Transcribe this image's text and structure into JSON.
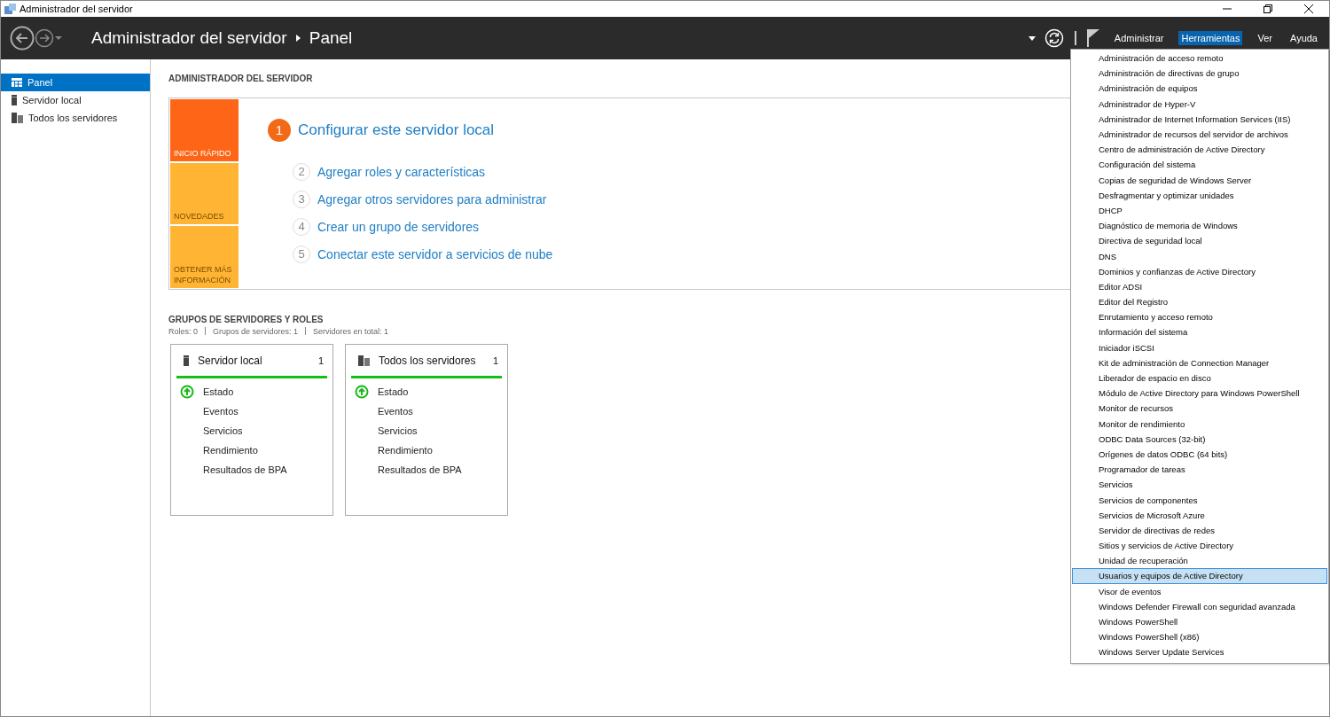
{
  "window": {
    "title": "Administrador del servidor"
  },
  "header": {
    "breadcrumb": [
      "Administrador del servidor",
      "Panel"
    ],
    "menus": [
      {
        "label": "Administrar",
        "selected": false
      },
      {
        "label": "Herramientas",
        "selected": true
      },
      {
        "label": "Ver",
        "selected": false
      },
      {
        "label": "Ayuda",
        "selected": false
      }
    ]
  },
  "sidebar": {
    "items": [
      {
        "label": "Panel",
        "kind": "dashboard",
        "selected": true
      },
      {
        "label": "Servidor local",
        "kind": "server",
        "selected": false
      },
      {
        "label": "Todos los servidores",
        "kind": "servers",
        "selected": false
      }
    ]
  },
  "welcome": {
    "heading": "ADMINISTRADOR DEL SERVIDOR",
    "tiles": [
      {
        "label": "INICIO RÁPIDO",
        "selected": true
      },
      {
        "label": "NOVEDADES",
        "selected": false
      },
      {
        "label": "OBTENER MÁS INFORMACIÓN",
        "selected": false
      }
    ],
    "steps": [
      {
        "number": "1",
        "label": "Configurar este servidor local",
        "kind": "main"
      },
      {
        "number": "2",
        "label": "Agregar roles y características",
        "kind": "step"
      },
      {
        "number": "3",
        "label": "Agregar otros servidores para administrar",
        "kind": "step"
      },
      {
        "number": "4",
        "label": "Crear un grupo de servidores",
        "kind": "step"
      },
      {
        "number": "5",
        "label": "Conectar este servidor a servicios de nube",
        "kind": "step"
      }
    ]
  },
  "groups": {
    "heading": "GRUPOS DE SERVIDORES Y ROLES",
    "summary": [
      "Roles: 0",
      "Grupos de servidores: 1",
      "Servidores en total: 1"
    ],
    "cards": [
      {
        "title": "Servidor local",
        "count": "1",
        "kind": "server",
        "rows": [
          {
            "label": "Estado",
            "ok": true
          },
          {
            "label": "Eventos",
            "ok": false
          },
          {
            "label": "Servicios",
            "ok": false
          },
          {
            "label": "Rendimiento",
            "ok": false
          },
          {
            "label": "Resultados de BPA",
            "ok": false
          }
        ]
      },
      {
        "title": "Todos los servidores",
        "count": "1",
        "kind": "servers",
        "rows": [
          {
            "label": "Estado",
            "ok": true
          },
          {
            "label": "Eventos",
            "ok": false
          },
          {
            "label": "Servicios",
            "ok": false
          },
          {
            "label": "Rendimiento",
            "ok": false
          },
          {
            "label": "Resultados de BPA",
            "ok": false
          }
        ]
      }
    ]
  },
  "tools_menu": {
    "items": [
      {
        "label": "Administración de acceso remoto",
        "selected": false
      },
      {
        "label": "Administración de directivas de grupo",
        "selected": false
      },
      {
        "label": "Administración de equipos",
        "selected": false
      },
      {
        "label": "Administrador de Hyper-V",
        "selected": false
      },
      {
        "label": "Administrador de Internet Information Services (IIS)",
        "selected": false
      },
      {
        "label": "Administrador de recursos del servidor de archivos",
        "selected": false
      },
      {
        "label": "Centro de administración de Active Directory",
        "selected": false
      },
      {
        "label": "Configuración del sistema",
        "selected": false
      },
      {
        "label": "Copias de seguridad de Windows Server",
        "selected": false
      },
      {
        "label": "Desfragmentar y optimizar unidades",
        "selected": false
      },
      {
        "label": "DHCP",
        "selected": false
      },
      {
        "label": "Diagnóstico de memoria de Windows",
        "selected": false
      },
      {
        "label": "Directiva de seguridad local",
        "selected": false
      },
      {
        "label": "DNS",
        "selected": false
      },
      {
        "label": "Dominios y confianzas de Active Directory",
        "selected": false
      },
      {
        "label": "Editor ADSI",
        "selected": false
      },
      {
        "label": "Editor del Registro",
        "selected": false
      },
      {
        "label": "Enrutamiento y acceso remoto",
        "selected": false
      },
      {
        "label": "Información del sistema",
        "selected": false
      },
      {
        "label": "Iniciador iSCSI",
        "selected": false
      },
      {
        "label": "Kit de administración de Connection Manager",
        "selected": false
      },
      {
        "label": "Liberador de espacio en disco",
        "selected": false
      },
      {
        "label": "Módulo de Active Directory para Windows PowerShell",
        "selected": false
      },
      {
        "label": "Monitor de recursos",
        "selected": false
      },
      {
        "label": "Monitor de rendimiento",
        "selected": false
      },
      {
        "label": "ODBC Data Sources (32-bit)",
        "selected": false
      },
      {
        "label": "Orígenes de datos ODBC (64 bits)",
        "selected": false
      },
      {
        "label": "Programador de tareas",
        "selected": false
      },
      {
        "label": "Servicios",
        "selected": false
      },
      {
        "label": "Servicios de componentes",
        "selected": false
      },
      {
        "label": "Servicios de Microsoft Azure",
        "selected": false
      },
      {
        "label": "Servidor de directivas de redes",
        "selected": false
      },
      {
        "label": "Sitios y servicios de Active Directory",
        "selected": false
      },
      {
        "label": "Unidad de recuperación",
        "selected": false
      },
      {
        "label": "Usuarios y equipos de Active Directory",
        "selected": true
      },
      {
        "label": "Visor de eventos",
        "selected": false
      },
      {
        "label": "Windows Defender Firewall con seguridad avanzada",
        "selected": false
      },
      {
        "label": "Windows PowerShell",
        "selected": false
      },
      {
        "label": "Windows PowerShell (x86)",
        "selected": false
      },
      {
        "label": "Windows Server Update Services",
        "selected": false
      }
    ]
  }
}
